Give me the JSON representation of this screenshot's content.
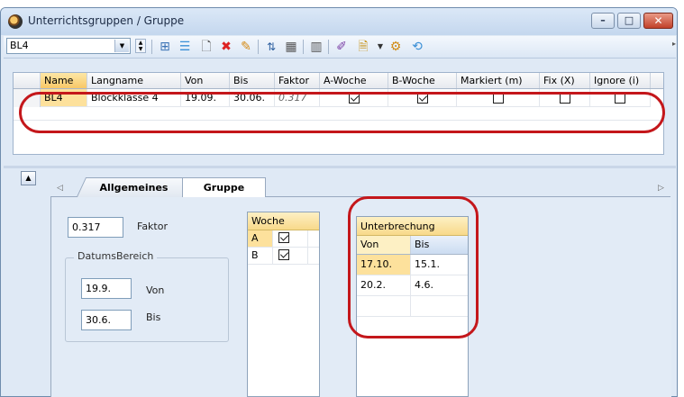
{
  "window": {
    "title": "Unterrichtsgruppen / Gruppe",
    "minimize": "–",
    "maximize": "□",
    "close": "✕"
  },
  "toolbar": {
    "combo_value": "BL4"
  },
  "grid": {
    "columns": [
      "Name",
      "Langname",
      "Von",
      "Bis",
      "Faktor",
      "A-Woche",
      "B-Woche",
      "Markiert (m)",
      "Fix (X)",
      "Ignore (i)"
    ],
    "row": {
      "name": "BL4",
      "langname": "Blockklasse 4",
      "von": "19.09.",
      "bis": "30.06.",
      "faktor": "0.317",
      "a_woche": true,
      "b_woche": true,
      "markiert": false,
      "fix": false,
      "ignore": false
    }
  },
  "tabs": {
    "allgemeines": "Allgemeines",
    "gruppe": "Gruppe"
  },
  "form": {
    "faktor_value": "0.317",
    "faktor_label": "Faktor",
    "datumsbereich_label": "DatumsBereich",
    "von_value": "19.9.",
    "von_label": "Von",
    "bis_value": "30.6.",
    "bis_label": "Bis"
  },
  "woche": {
    "header": "Woche",
    "rows": [
      {
        "key": "A",
        "checked": true
      },
      {
        "key": "B",
        "checked": true
      }
    ]
  },
  "unterbrechung": {
    "header": "Unterbrechung",
    "col_von": "Von",
    "col_bis": "Bis",
    "rows": [
      {
        "von": "17.10.",
        "bis": "15.1."
      },
      {
        "von": "20.2.",
        "bis": "4.6."
      }
    ]
  },
  "colors": {
    "highlight": "#c4171b",
    "selection": "#fde19c",
    "window_bg": "#dfe9f5"
  }
}
